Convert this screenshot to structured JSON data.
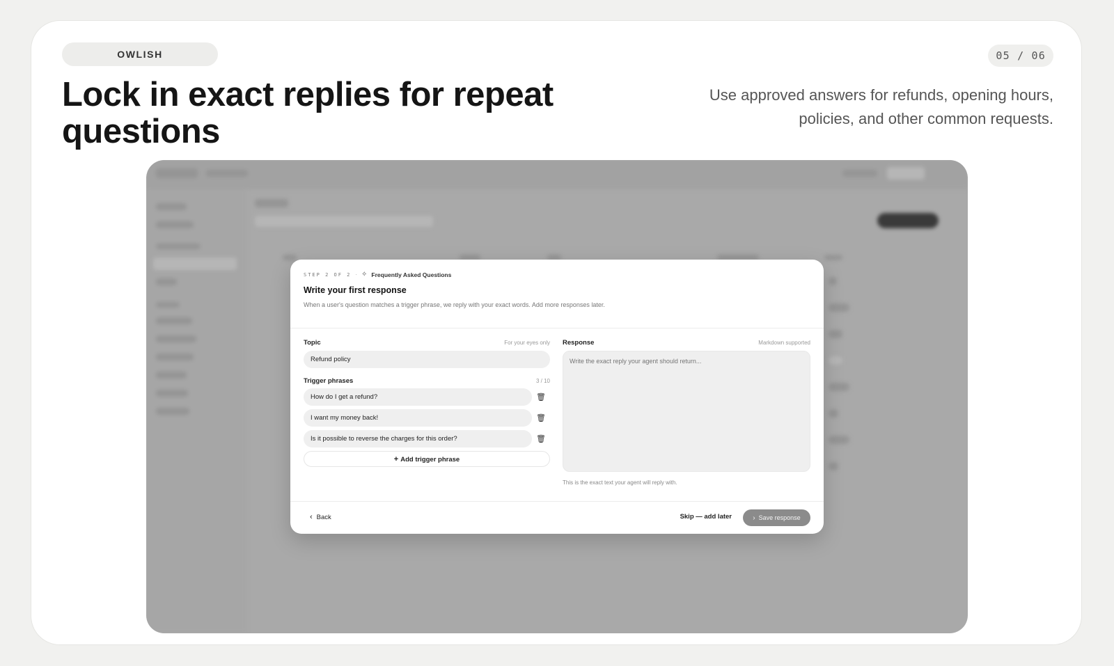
{
  "header": {
    "brand": "OWLISH",
    "page_indicator": "05 / 06",
    "headline": "Lock in exact replies for repeat questions",
    "subheadline": "Use approved answers for refunds, opening hours, policies, and other common requests."
  },
  "modal": {
    "step_label": "STEP 2 OF 2",
    "step_separator": "·",
    "section_name": "Frequently Asked Questions",
    "title": "Write your first response",
    "description": "When a user's question matches a trigger phrase, we reply with your exact words. Add more responses later.",
    "topic": {
      "label": "Topic",
      "note": "For your eyes only",
      "value": "Refund policy"
    },
    "triggers": {
      "label": "Trigger phrases",
      "count": "3 / 10",
      "items": [
        "How do I get a refund?",
        "I want my money back!",
        "Is it possible to reverse the charges for this order?"
      ],
      "add_label": "Add trigger phrase"
    },
    "response": {
      "label": "Response",
      "note": "Markdown supported",
      "placeholder": "Write the exact reply your agent should return...",
      "help": "This is the exact text your agent will reply with."
    },
    "footer": {
      "back_label": "Back",
      "skip_label": "Skip — add later",
      "save_label": "Save response"
    }
  },
  "icons": {
    "faq": "sparkle-icon",
    "delete": "trash-icon",
    "add": "plus-icon",
    "back": "chevron-left-icon",
    "save": "chevron-right-icon"
  },
  "colors": {
    "page_bg": "#f1f1ef",
    "card_bg": "#ffffff",
    "save_button": "#8b8b8b",
    "app_overlay": "#a9a9a9"
  }
}
